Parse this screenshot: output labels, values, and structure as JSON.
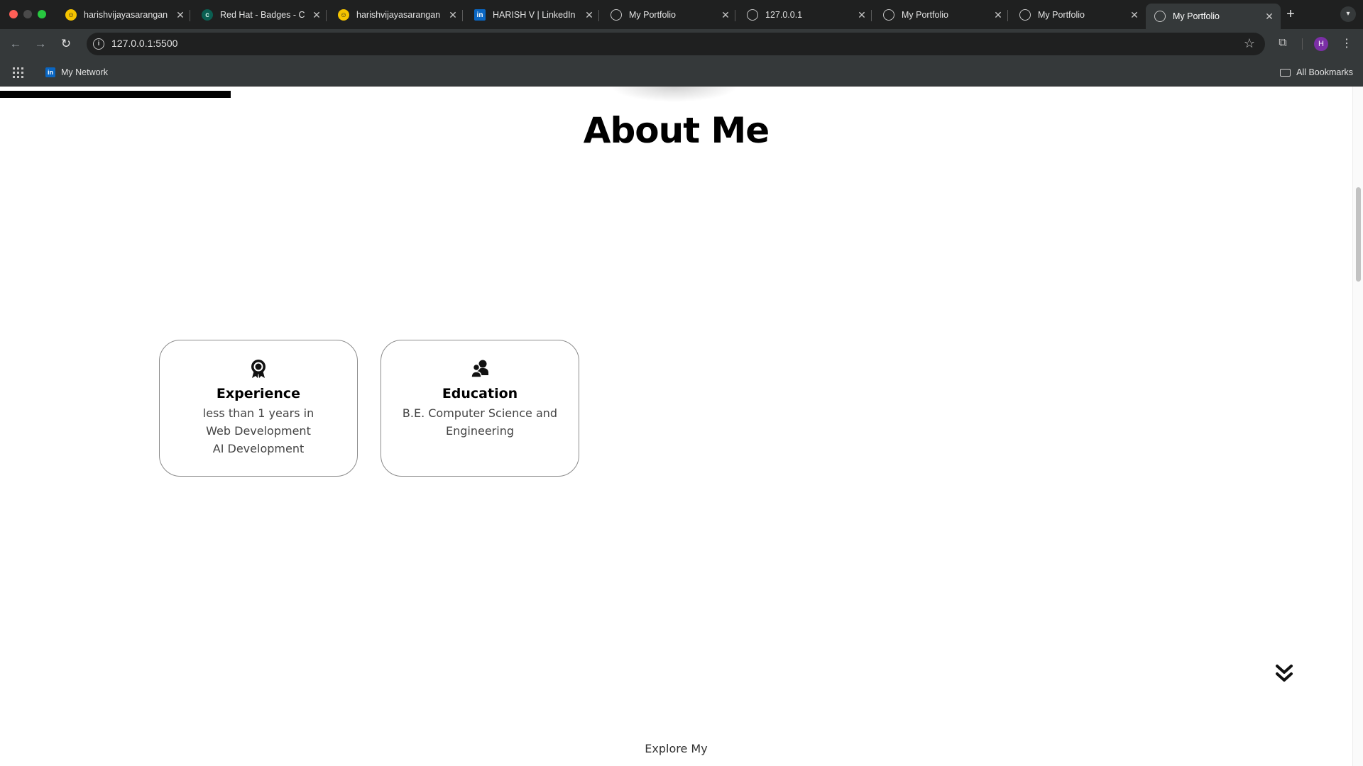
{
  "browser": {
    "tabs": [
      {
        "title": "harishvijayasarangan",
        "favicon": "huggingface-icon"
      },
      {
        "title": "Red Hat - Badges - C",
        "favicon": "credly-icon"
      },
      {
        "title": "harishvijayasarangan",
        "favicon": "huggingface-icon"
      },
      {
        "title": "HARISH V | LinkedIn",
        "favicon": "linkedin-icon"
      },
      {
        "title": "My Portfolio",
        "favicon": "globe-icon"
      },
      {
        "title": "127.0.0.1",
        "favicon": "globe-icon"
      },
      {
        "title": "My Portfolio",
        "favicon": "globe-icon"
      },
      {
        "title": "My Portfolio",
        "favicon": "globe-icon"
      },
      {
        "title": "My Portfolio",
        "favicon": "globe-icon",
        "active": true
      }
    ],
    "close_glyph": "✕",
    "url": "127.0.0.1:5500",
    "avatar_letter": "H",
    "bookmarks": [
      {
        "label": "My Network",
        "favicon": "linkedin-icon"
      }
    ],
    "all_bookmarks_label": "All Bookmarks"
  },
  "page": {
    "heading": "About Me",
    "cards": {
      "experience": {
        "title": "Experience",
        "lines": [
          "less than 1 years in",
          "Web Development",
          "AI Development"
        ],
        "icon": "award-icon"
      },
      "education": {
        "title": "Education",
        "lines": [
          "B.E. Computer Science and",
          "Engineering"
        ],
        "icon": "users-icon"
      }
    },
    "explore_text": "Explore My",
    "scroll_down_icon": "double-chevron-down-icon"
  },
  "colors": {
    "tabstrip_bg": "#1f2020",
    "toolbar_bg": "#35393a",
    "avatar_bg": "#7b2fa6",
    "card_border": "#8c8c8c"
  }
}
